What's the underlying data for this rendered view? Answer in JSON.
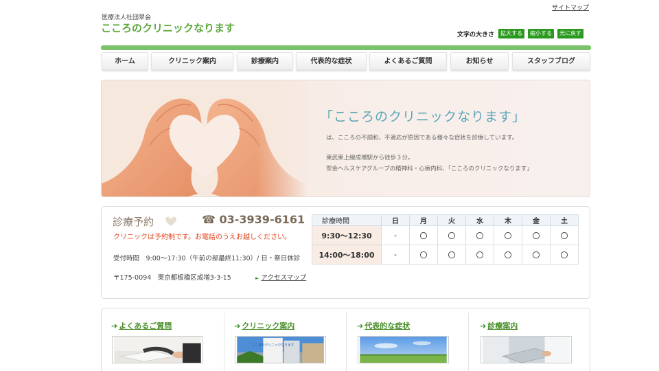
{
  "header": {
    "org_name": "医療法人社団翠会",
    "clinic_title": "こころのクリニックなります",
    "sitemap_link": "サイトマップ",
    "font_size_label": "文字の大きさ",
    "font_buttons": [
      "拡大する",
      "縮小する",
      "元に戻す"
    ]
  },
  "nav": {
    "items": [
      "ホーム",
      "クリニック案内",
      "診療案内",
      "代表的な症状",
      "よくあるご質問",
      "お知らせ",
      "スタッフブログ"
    ]
  },
  "hero": {
    "title": "「こころのクリニックなります」",
    "line1": "は、こころの不調和、不適応が原因である様々な症状を診療しています。",
    "line2": "東武東上線成増駅から徒歩３分。",
    "line3": "翠会ヘルスケアグループの精神科・心療内科、「こころのクリニックなります」"
  },
  "reservation": {
    "label": "診療予約",
    "phone": "☎ 03-3939-6161",
    "note": "クリニックは予約制です。お電話のうえお越しください。",
    "hours_text": "受付時間　9:00～17:30（午前の部最終11:30）/ 日・祭日休診",
    "address": "〒175-0094　東京都板橋区成増3-3-15",
    "access_link": "アクセスマップ"
  },
  "schedule": {
    "header_label": "診療時間",
    "days": [
      "日",
      "月",
      "火",
      "水",
      "木",
      "金",
      "土"
    ],
    "rows": [
      {
        "time": "9:30～12:30",
        "marks": [
          "-",
          "〇",
          "〇",
          "〇",
          "〇",
          "〇",
          "〇"
        ]
      },
      {
        "time": "14:00～18:00",
        "marks": [
          "-",
          "〇",
          "〇",
          "〇",
          "〇",
          "〇",
          "〇"
        ]
      }
    ]
  },
  "cards": [
    {
      "label": "よくあるご質問",
      "icon": "arrow-right-icon"
    },
    {
      "label": "クリニック案内",
      "icon": "arrow-right-icon",
      "sign_text": "こころのクリニックなります"
    },
    {
      "label": "代表的な症状",
      "icon": "arrow-right-icon"
    },
    {
      "label": "診療案内",
      "icon": "arrow-right-icon"
    }
  ],
  "colors": {
    "accent_green": "#5aa83a",
    "button_green": "#2a9a1f",
    "nav_green": "#7cc26a",
    "hero_title": "#5aa7b8",
    "note_orange": "#e2461f"
  }
}
